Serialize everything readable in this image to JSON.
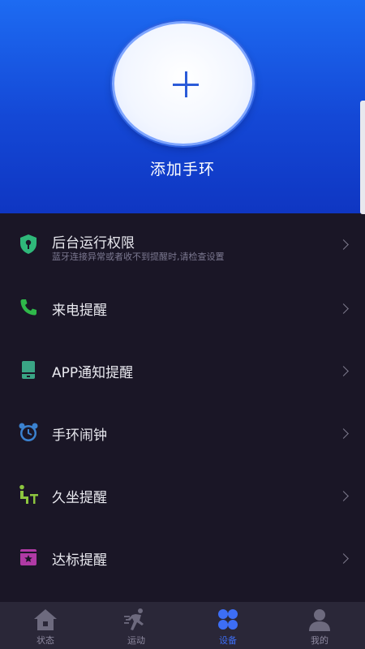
{
  "header": {
    "add_label": "添加手环"
  },
  "list": {
    "items": [
      {
        "title": "后台运行权限",
        "subtitle": "蓝牙连接异常或者收不到提醒时,请检查设置",
        "icon": "shield-key-icon",
        "color": "#2fb87a"
      },
      {
        "title": "来电提醒",
        "icon": "phone-icon",
        "color": "#2fb84a"
      },
      {
        "title": "APP通知提醒",
        "icon": "tablet-icon",
        "color": "#3aa585"
      },
      {
        "title": "手环闹钟",
        "icon": "alarm-clock-icon",
        "color": "#3b82d0"
      },
      {
        "title": "久坐提醒",
        "icon": "sitting-person-icon",
        "color": "#8dc63f"
      },
      {
        "title": "达标提醒",
        "icon": "goal-badge-icon",
        "color": "#b03aa5"
      }
    ]
  },
  "tabbar": {
    "items": [
      {
        "label": "状态",
        "icon": "home-icon"
      },
      {
        "label": "运动",
        "icon": "running-icon"
      },
      {
        "label": "设备",
        "icon": "device-grid-icon",
        "active": true
      },
      {
        "label": "我的",
        "icon": "user-icon"
      }
    ],
    "active_color": "#3d6ef5",
    "inactive_color": "#8e8aa0"
  }
}
